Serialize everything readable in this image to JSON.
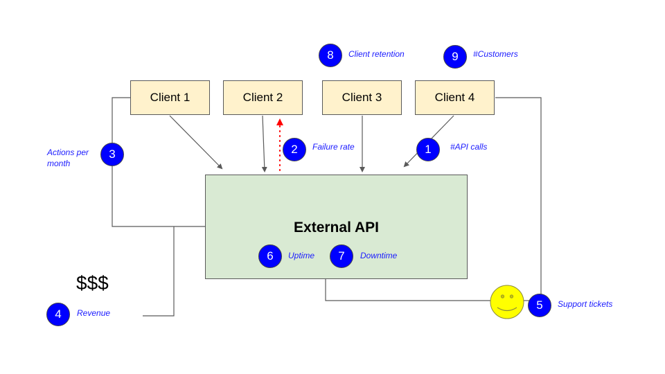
{
  "diagram": {
    "clients": [
      {
        "label": "Client 1"
      },
      {
        "label": "Client 2"
      },
      {
        "label": "Client 3"
      },
      {
        "label": "Client 4"
      }
    ],
    "api": {
      "label": "External API"
    },
    "money_symbol": "$$$",
    "metrics": [
      {
        "number": "1",
        "label": "#API calls"
      },
      {
        "number": "2",
        "label": "Failure rate"
      },
      {
        "number": "3",
        "label": "Actions per month"
      },
      {
        "number": "4",
        "label": "Revenue"
      },
      {
        "number": "5",
        "label": "Support tickets"
      },
      {
        "number": "6",
        "label": "Uptime"
      },
      {
        "number": "7",
        "label": "Downtime"
      },
      {
        "number": "8",
        "label": "Client retention"
      },
      {
        "number": "9",
        "label": "#Customers"
      }
    ],
    "colors": {
      "client_fill": "#fff2cc",
      "api_fill": "#d9ead3",
      "badge_fill": "#0000ff",
      "label_text": "#1a1aff",
      "failure_arrow": "#ff0000",
      "smiley_fill": "#ffff00"
    }
  }
}
